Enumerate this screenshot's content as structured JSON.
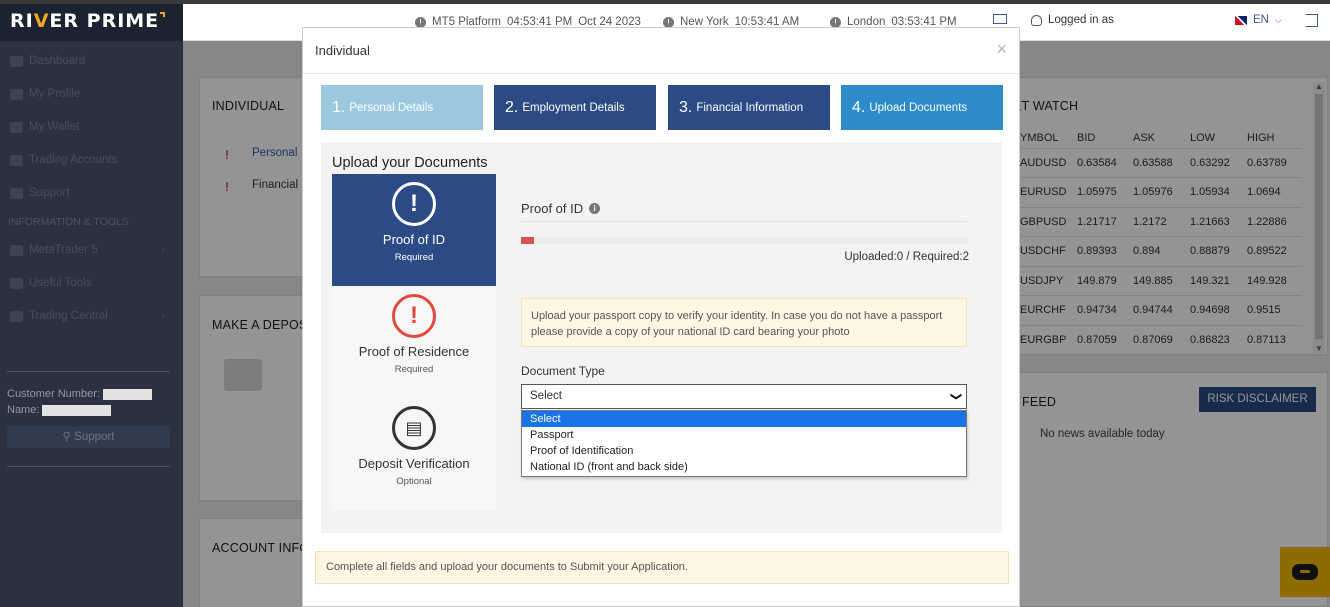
{
  "brand": {
    "name_part1": "RI",
    "name_i": "V",
    "name_part2": "ER PRIME"
  },
  "sidebar": {
    "items": [
      {
        "label": "Dashboard"
      },
      {
        "label": "My Profile"
      },
      {
        "label": "My Wallet"
      },
      {
        "label": "Trading Accounts"
      },
      {
        "label": "Support"
      }
    ],
    "section_label": "INFORMATION & TOOLS",
    "tools": [
      {
        "label": "MetaTrader 5"
      },
      {
        "label": "Useful Tools"
      },
      {
        "label": "Trading Central"
      }
    ],
    "customer_number_label": "Customer Number:",
    "name_label": "Name:",
    "support_label": "Support"
  },
  "header": {
    "clocks": [
      {
        "label": "MT5 Platform",
        "time": "04:53:41 PM",
        "date": "Oct 24 2023"
      },
      {
        "label": "New York",
        "time": "10:53:41 AM"
      },
      {
        "label": "London",
        "time": "03:53:41 PM"
      }
    ],
    "logged_in_label": "Logged in as",
    "language": "EN"
  },
  "background": {
    "individual_title": "INDIVIDUAL",
    "individual_items": [
      "Personal",
      "Financial"
    ],
    "deposit_title": "MAKE A DEPOS",
    "account_title": "ACCOUNT INFO",
    "watch_title": "ET WATCH",
    "watch_headers": [
      "YMBOL",
      "BID",
      "ASK",
      "LOW",
      "HIGH"
    ],
    "watch_rows": [
      [
        "AUDUSD",
        "0.63584",
        "0.63588",
        "0.63292",
        "0.63789"
      ],
      [
        "EURUSD",
        "1.05975",
        "1.05976",
        "1.05934",
        "1.0694"
      ],
      [
        "GBPUSD",
        "1.21717",
        "1.2172",
        "1.21663",
        "1.22886"
      ],
      [
        "USDCHF",
        "0.89393",
        "0.894",
        "0.88879",
        "0.89522"
      ],
      [
        "USDJPY",
        "149.879",
        "149.885",
        "149.321",
        "149.928"
      ],
      [
        "EURCHF",
        "0.94734",
        "0.94744",
        "0.94698",
        "0.9515"
      ],
      [
        "EURGBP",
        "0.87059",
        "0.87069",
        "0.86823",
        "0.87113"
      ]
    ],
    "feed_title": "FEED",
    "risk_label": "RISK DISCLAIMER",
    "no_news": "No news available today"
  },
  "modal": {
    "title": "Individual",
    "close": "×",
    "steps": [
      {
        "num": "1.",
        "label": "Personal Details"
      },
      {
        "num": "2.",
        "label": "Employment Details"
      },
      {
        "num": "3.",
        "label": "Financial Information"
      },
      {
        "num": "4.",
        "label": "Upload Documents"
      }
    ],
    "upload_heading": "Upload your Documents",
    "documents": [
      {
        "name": "Proof of ID",
        "status": "Required",
        "icon": "exclamation-icon"
      },
      {
        "name": "Proof of Residence",
        "status": "Required",
        "icon": "exclamation-icon"
      },
      {
        "name": "Deposit Verification",
        "status": "Optional",
        "icon": "document-icon"
      }
    ],
    "proof_title": "Proof of ID",
    "progress": {
      "uploaded": 0,
      "required": 2,
      "fill_fraction": 0.03
    },
    "uploaded_text": "Uploaded:0 / Required:2",
    "notice": "Upload your passport copy to verify your identity. In case you do not have a passport please provide a copy of your national ID card bearing your photo",
    "document_type_label": "Document Type",
    "select_value": "Select",
    "options": [
      "Select",
      "Passport",
      "Proof of Identification",
      "National ID (front and back side)"
    ],
    "footer_note": "Complete all fields and upload your documents to Submit your Application."
  }
}
